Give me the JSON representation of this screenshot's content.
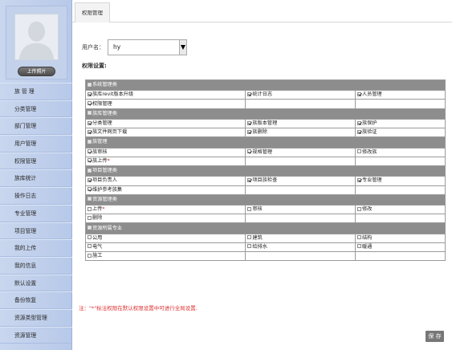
{
  "sidebar": {
    "upload_label": "上传照片",
    "menu": [
      "族 管 理",
      "分类管理",
      "部门管理",
      "用户管理",
      "权限管理",
      "族库统计",
      "操作日志",
      "专业管理",
      "项目管理",
      "我的上传",
      "我的信息",
      "默认设置",
      "备份恢复",
      "资源类型管理",
      "资源管理"
    ]
  },
  "tab": {
    "label": "权限管理"
  },
  "user": {
    "label": "用户名：",
    "value": "hy"
  },
  "perm_title": "权限设置:",
  "groups": [
    {
      "name": "系统管理类",
      "rows": [
        [
          {
            "label": "族库revit版本升级",
            "checked": true
          },
          {
            "label": "统计日志",
            "checked": true
          },
          {
            "label": "人员管理",
            "checked": true
          }
        ],
        [
          {
            "label": "权限管理",
            "checked": true
          },
          {
            "label": "",
            "checked": null
          },
          {
            "label": "",
            "checked": null
          }
        ]
      ]
    },
    {
      "name": "族库管理类",
      "rows": [
        [
          {
            "label": "分类管理",
            "checked": true
          },
          {
            "label": "族版本管理",
            "checked": true
          },
          {
            "label": "族保护",
            "checked": true
          }
        ],
        [
          {
            "label": "族文件网页下载",
            "checked": true
          },
          {
            "label": "族删除",
            "checked": true
          },
          {
            "label": "族验证",
            "checked": true
          }
        ]
      ]
    },
    {
      "name": "族管理",
      "rows": [
        [
          {
            "label": "族审核",
            "checked": true
          },
          {
            "label": "规格管理",
            "checked": true
          },
          {
            "label": "修改族",
            "checked": false
          }
        ],
        [
          {
            "label": "族上传",
            "checked": true,
            "required": true
          },
          {
            "label": "",
            "checked": null
          },
          {
            "label": "",
            "checked": null
          }
        ]
      ]
    },
    {
      "name": "项目管理类",
      "rows": [
        [
          {
            "label": "项目负责人",
            "checked": true
          },
          {
            "label": "项目族检查",
            "checked": true
          },
          {
            "label": "专业管理",
            "checked": true
          }
        ],
        [
          {
            "label": "维护参考族集",
            "checked": true
          },
          {
            "label": "",
            "checked": null
          },
          {
            "label": "",
            "checked": null
          }
        ]
      ]
    },
    {
      "name": "资源管理类",
      "rows": [
        [
          {
            "label": "上传",
            "checked": false,
            "required": true
          },
          {
            "label": "审核",
            "checked": false
          },
          {
            "label": "修改",
            "checked": false
          }
        ],
        [
          {
            "label": "删除",
            "checked": false
          },
          {
            "label": "",
            "checked": null
          },
          {
            "label": "",
            "checked": null
          }
        ]
      ]
    },
    {
      "name": "资源所属专业",
      "rows": [
        [
          {
            "label": "公用",
            "checked": false
          },
          {
            "label": "建筑",
            "checked": false
          },
          {
            "label": "结构",
            "checked": false
          }
        ],
        [
          {
            "label": "电气",
            "checked": false
          },
          {
            "label": "给排水",
            "checked": false
          },
          {
            "label": "暖通",
            "checked": false
          }
        ],
        [
          {
            "label": "施工",
            "checked": false
          },
          {
            "label": "",
            "checked": null
          },
          {
            "label": "",
            "checked": null
          }
        ]
      ]
    }
  ],
  "note": "注：\"*\"标注权限在默认权限设置中可进行全局设置.",
  "save_label": "保 存"
}
